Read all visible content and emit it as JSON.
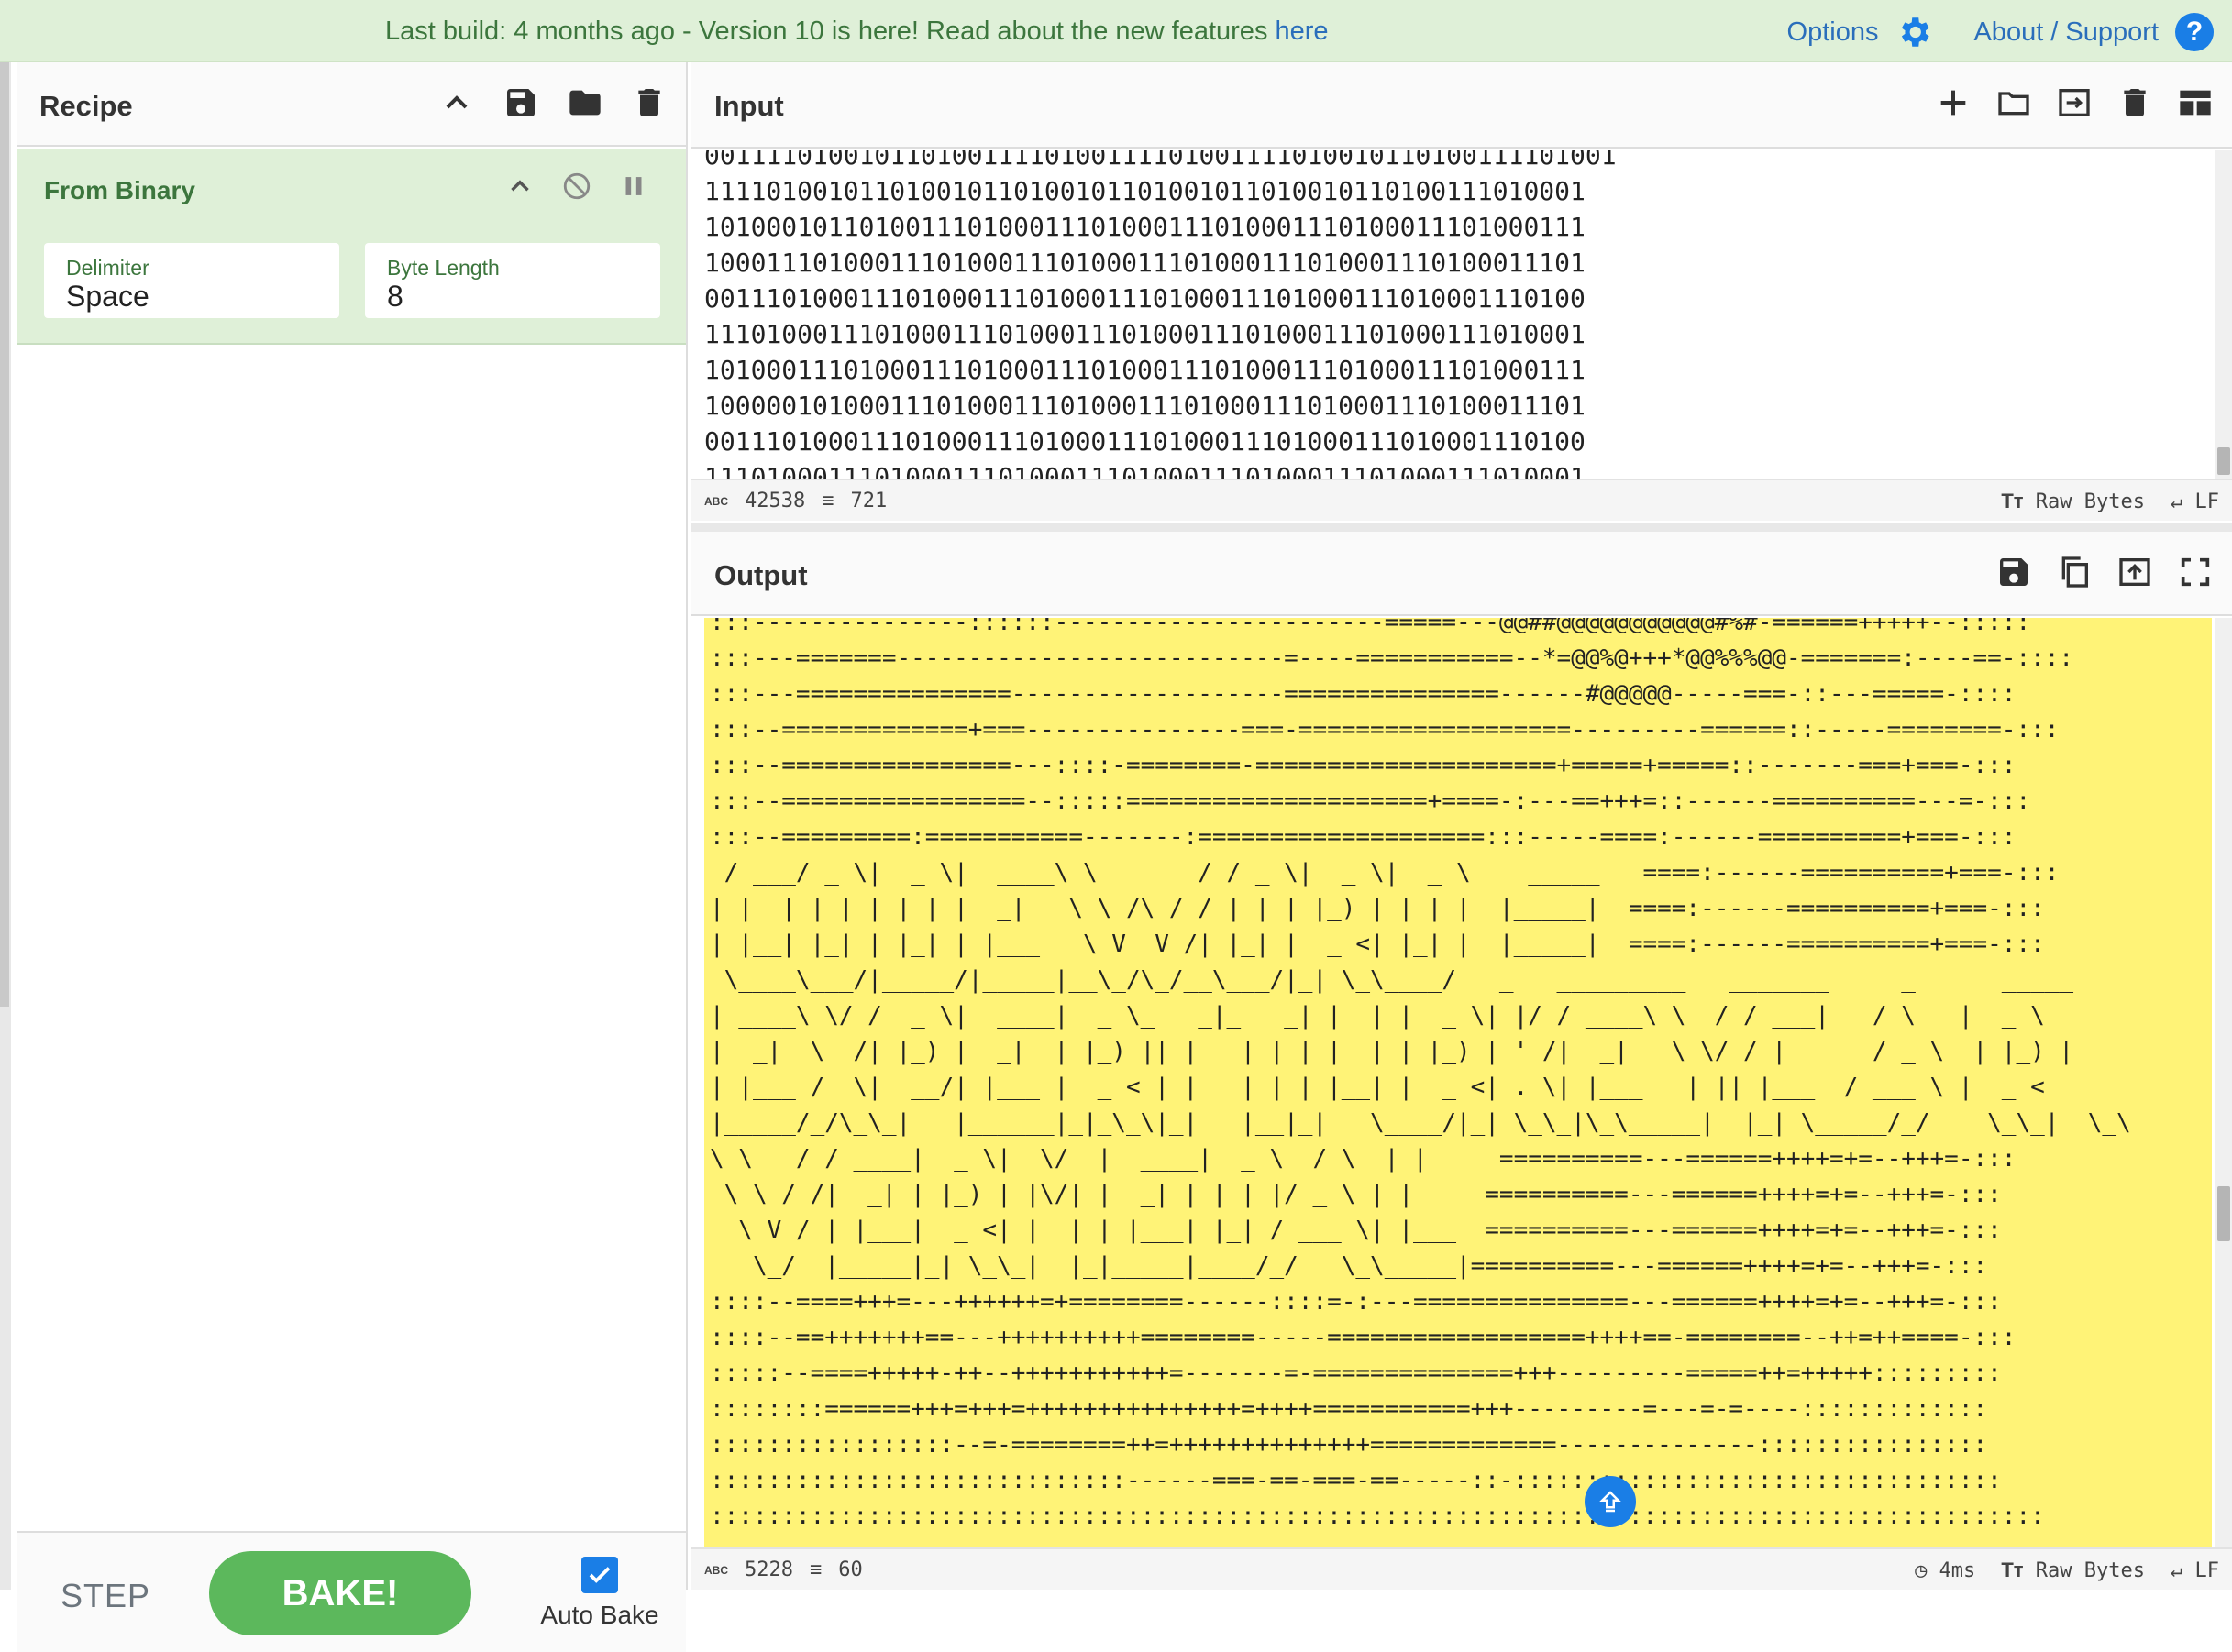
{
  "topbar": {
    "notice_prefix": "Last build: 4 months ago - Version 10 is here! Read about the new features ",
    "notice_link": "here",
    "options_label": "Options",
    "about_label": "About / Support"
  },
  "recipe": {
    "title": "Recipe",
    "operation": {
      "name": "From Binary",
      "delimiter_label": "Delimiter",
      "delimiter_value": "Space",
      "byte_length_label": "Byte Length",
      "byte_length_value": "8"
    },
    "step_label": "STEP",
    "bake_label": "BAKE!",
    "auto_bake_label": "Auto Bake",
    "auto_bake_checked": true
  },
  "input": {
    "title": "Input",
    "lines": [
      "00111101001011010011110100111101001111010010110100111101001",
      "111101001011010010110100101101001011010010110100111010001",
      "101000101101001110100011101000111010001110100011101000111",
      "100011101000111010001110100011101000111010001110100011101",
      "001110100011101000111010001110100011101000111010001110100",
      "111010001110100011101000111010001110100011101000111010001",
      "101000111010001110100011101000111010001110100011101000111",
      "100000101000111010001110100011101000111010001110100011101",
      "001110100011101000111010001110100011101000111010001110100",
      "111010001110100011101000111010001110100011101000111010001"
    ],
    "status": {
      "chars": "42538",
      "lines": "721",
      "encoding": "Raw Bytes",
      "eol": "LF"
    }
  },
  "output": {
    "title": "Output",
    "lines": [
      ":::---------------::::::-----------------------=====---@@##@@@@@@@@@@@#%#-======+++++--:::::",
      ":::---=======---------------------------=----===========--*=@@%@+++*@@%%%@@-=======:----==-::::",
      ":::---===============-------------------===============------#@@@@@-----===-::---=====-::::",
      ":::--=============+===---------------===-===================---------======::-----========-:::",
      ":::--================---::::-========-=====================+=====+=====::-------===+===-:::",
      ":::--=================--:::::=====================+====-:---==+++=::------==========---=-:::",
      ":::--=========:===========-------:====================:::-----====:------==========+===-:::",
      " / ___/ _ \\|  _ \\|  ____\\ \\       / / _ \\|  _ \\|  _ \\    _____   ====:------==========+===-:::",
      "| |  | | | | | | |  _|   \\ \\ /\\ / / | | | |_) | | | |  |_____|  ====:------==========+===-:::",
      "| |__| |_| | |_| | |___   \\ V  V /| |_| |  _ <| |_| |  |_____|  ====:------==========+===-:::",
      " \\____\\___/|_____/|_____|__\\_/\\_/__\\___/|_| \\_\\____/   _   _________   _______     _      _____",
      "| ____\\ \\/ /  _ \\|  ____|  _ \\_   _|_   _| |  | |  _ \\| |/ / ____\\ \\  / / ___|   / \\   |  _ \\",
      "|  _|  \\  /| |_) |  _|  | |_) || |   | | | |  | | |_) | ' /|  _|   \\ \\/ / |      / _ \\  | |_) |",
      "| |___ /  \\|  __/| |___ |  _ < | |   | | | |__| |  _ <| . \\| |___   | || |___  / ___ \\ |  _ <",
      "|_____/_/\\_\\_|   |______|_|_\\_\\|_|   |__|_|   \\____/|_| \\_\\_|\\_\\_____|  |_| \\_____/_/    \\_\\_|  \\_\\",
      "\\ \\   / / ____|  _ \\|  \\/  |  ____|  _ \\  / \\  | |     ==========---======++++=+=--+++=-:::",
      " \\ \\ / /|  _| | |_) | |\\/| |  _| | | | |/ _ \\ | |     ==========---======++++=+=--+++=-:::",
      "  \\ V / | |___|  _ <| |  | | |___| |_| / ___ \\| |___  ==========---======++++=+=--+++=-:::",
      "   \\_/  |_____|_| \\_\\_|  |_|_____|____/_/   \\_\\_____|==========---======++++=+=--+++=-:::",
      "::::--====+++=---++++++=+========------::::=-:---===============---======++++=+=--+++=-:::",
      "::::--==+++++++==---++++++++++========-----==================++++==-========--++=++====-:::",
      ":::::--====+++++-++--+++++++++++=-------=-==============+++---------=====++=+++++:::::::::",
      "::::::::======+++=+++=+++++++++++++++=++++===========+++---------=---=-=----:::::::::::::",
      ":::::::::::::::::--=-========++=++++++++++++++=============--------------::::::::::::::::",
      ":::::::::::::::::::::::::::::------===-==-===-==-----::-::::::::::::::::::::::::::::::::::",
      ":::::::::::::::::::::::::::::::::::::::::::::::::::::::::::::::::::::::::::::::::::::::::::::"
    ],
    "status": {
      "chars": "5228",
      "lines": "60",
      "time": "4ms",
      "encoding": "Raw Bytes",
      "eol": "LF"
    }
  }
}
